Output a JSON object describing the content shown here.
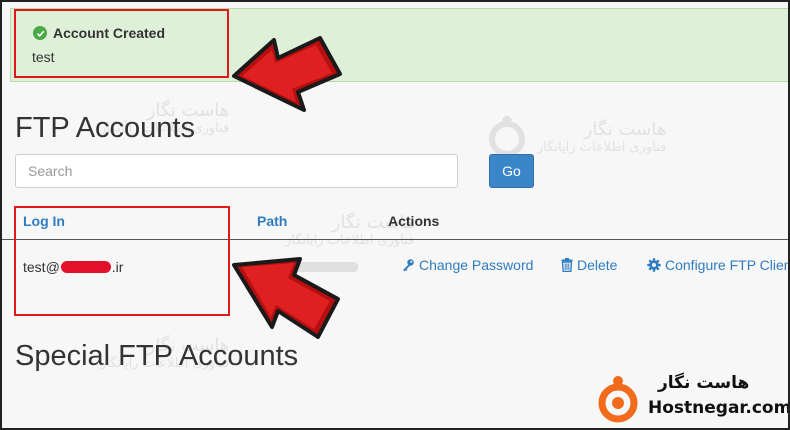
{
  "alert": {
    "title": "Account Created",
    "message": "test"
  },
  "ftp_accounts": {
    "heading": "FTP Accounts",
    "search_placeholder": "Search",
    "go_label": "Go",
    "columns": {
      "login": "Log In",
      "path": "Path",
      "actions": "Actions"
    },
    "row": {
      "login_prefix": "test@",
      "login_suffix": ".ir",
      "actions": {
        "change_password": "Change Password",
        "delete": "Delete",
        "configure": "Configure FTP Clien"
      }
    }
  },
  "special_ftp_accounts": {
    "heading": "Special FTP Accounts"
  },
  "watermark": {
    "name_fa": "هاست نگار",
    "tagline_fa": "فناوری اطلاعات رایانگار"
  },
  "logo": {
    "name_fa": "هاست نگار",
    "name_en": "Hostnegar.com"
  },
  "colors": {
    "accent": "#3a86c8",
    "link": "#2f7cc0",
    "success_bg": "#dff0d8",
    "highlight": "#e01919",
    "logo_orange": "#f26a1b"
  }
}
